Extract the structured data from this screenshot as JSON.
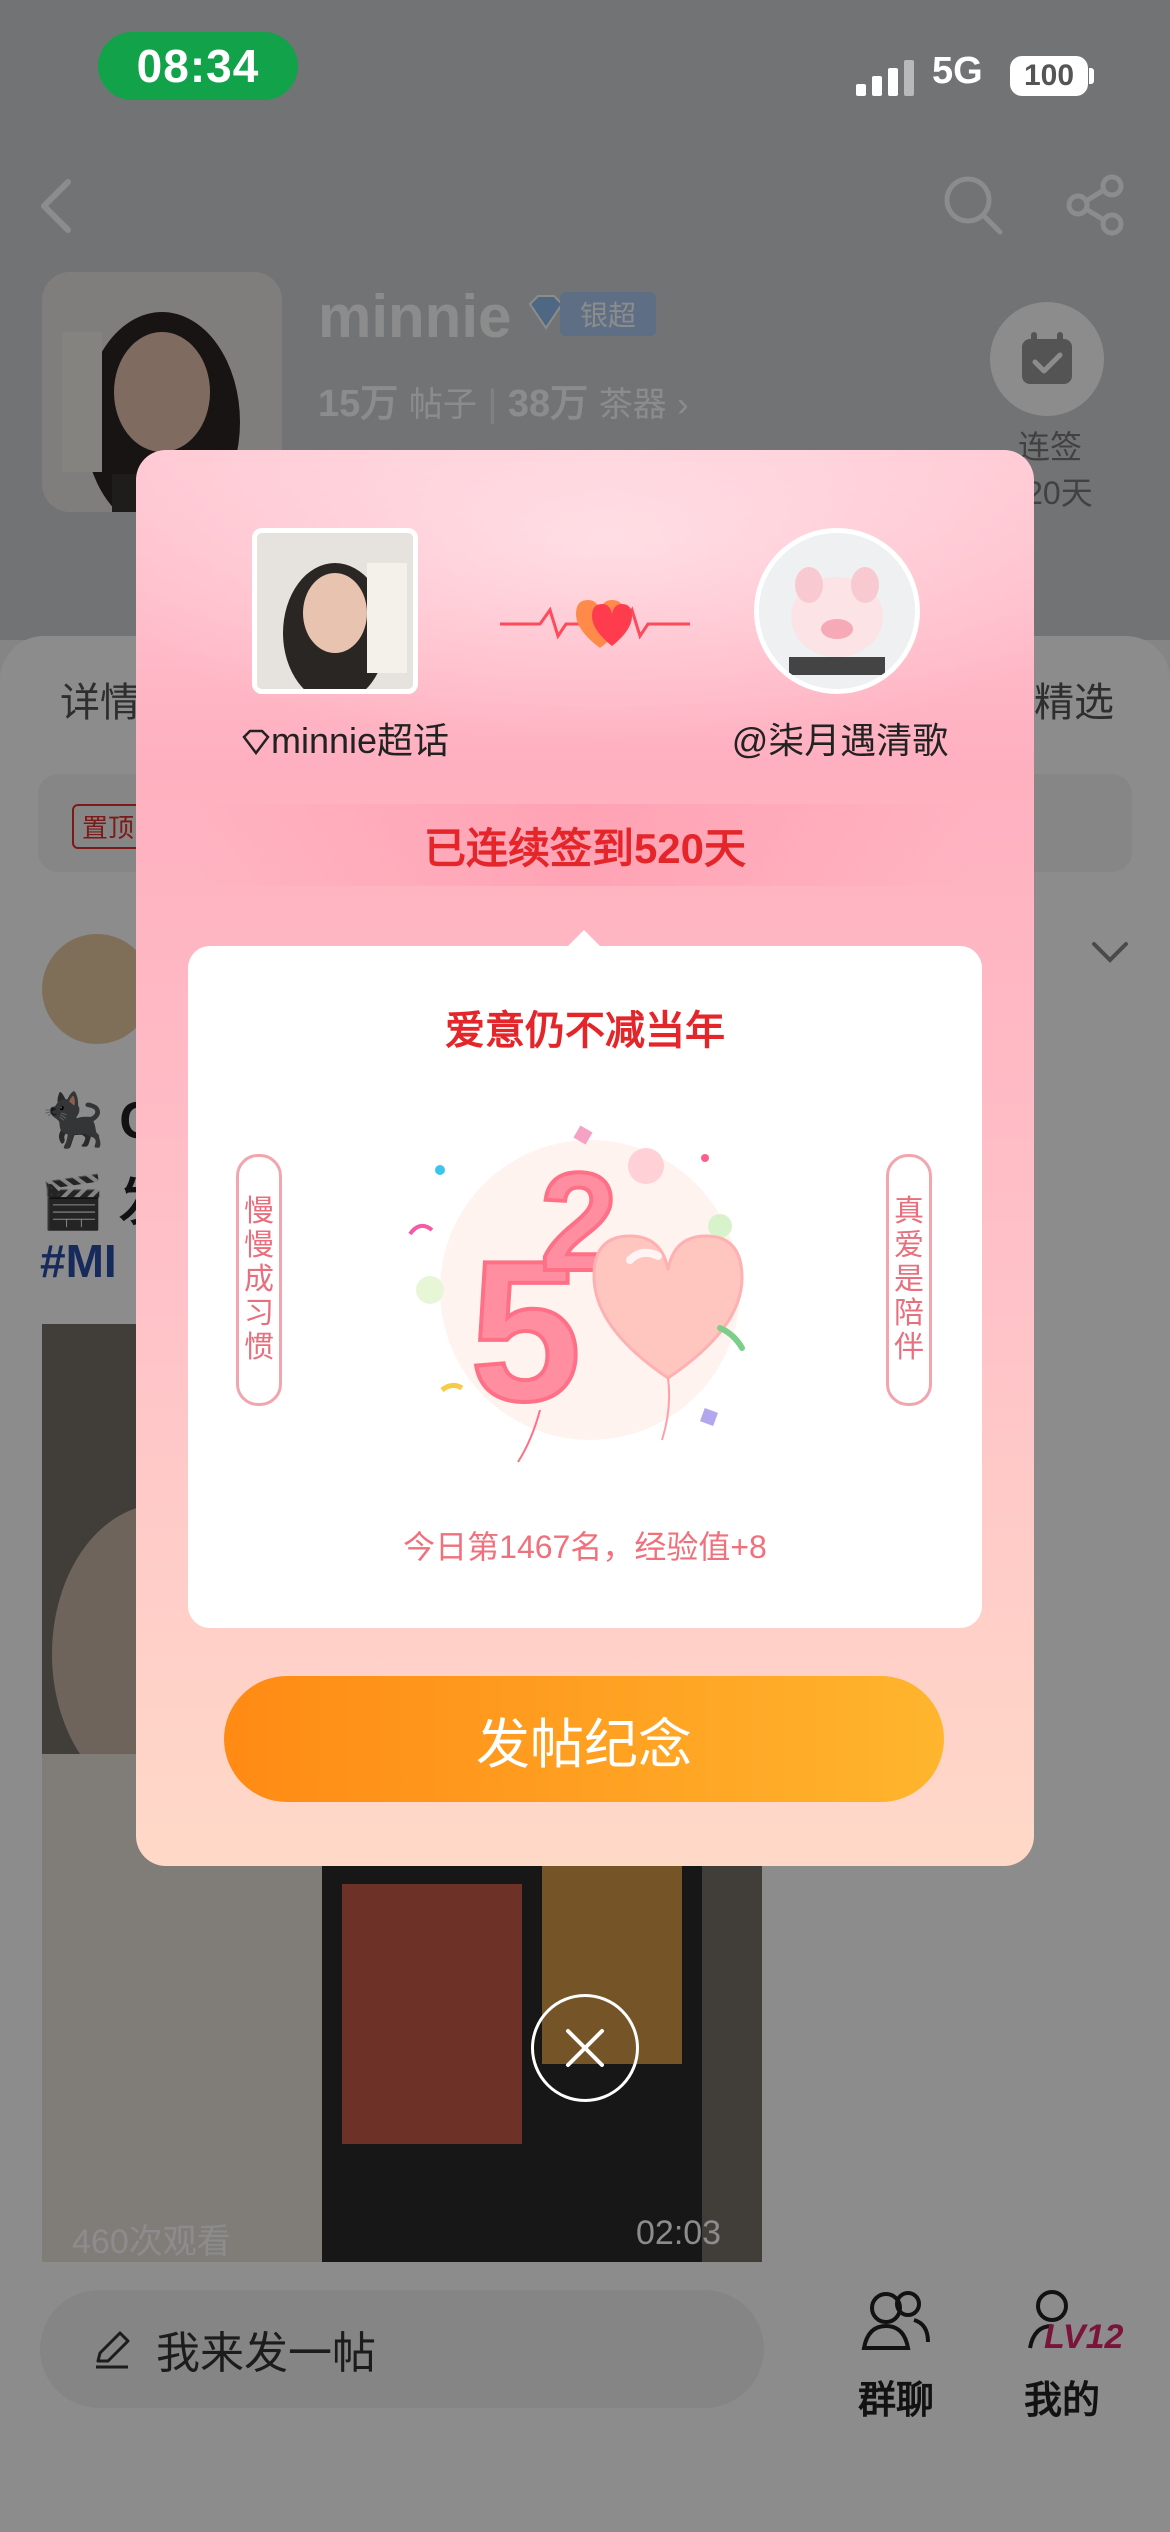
{
  "status_bar": {
    "time": "08:34",
    "network": "5G",
    "battery": "100"
  },
  "header": {
    "name": "minnie",
    "badge": "银超",
    "posts_count": "15万",
    "posts_label": "帖子",
    "fans_count": "38万",
    "fans_label": "茶器",
    "checkin_label_1": "连签",
    "checkin_label_2": "520天"
  },
  "tabs": {
    "left": "详情",
    "right": "精选"
  },
  "pinned": {
    "tag": "置顶"
  },
  "post": {
    "line1": "🐈‍⬛ C",
    "line2": "🎬 发",
    "hashtag": "#MI",
    "video_views": "460次观看",
    "video_duration": "02:03"
  },
  "bottom": {
    "compose_placeholder": "我来发一帖",
    "group_label": "群聊",
    "me_label": "我的",
    "level": "LV12"
  },
  "modal": {
    "left_name": "minnie超话",
    "right_name": "@柒月遇清歌",
    "streak_text": "已连续签到520天",
    "card_title": "爱意仍不减当年",
    "left_scroll": [
      "慢",
      "慢",
      "成",
      "习",
      "惯"
    ],
    "right_scroll": [
      "真",
      "爱",
      "是",
      "陪",
      "伴"
    ],
    "illustration_number": "520",
    "footer_text": "今日第1467名，经验值+8",
    "button_label": "发帖纪念"
  },
  "colors": {
    "accent_red": "#e4262b",
    "button_orange": "#ff8a14",
    "status_green": "#12a24a"
  }
}
